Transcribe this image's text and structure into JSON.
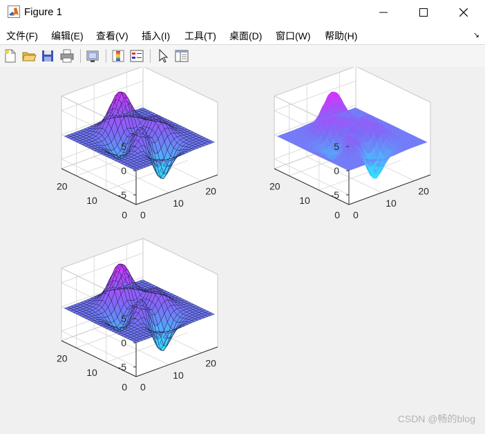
{
  "window": {
    "title": "Figure 1"
  },
  "menu": [
    "文件(F)",
    "编辑(E)",
    "查看(V)",
    "插入(I)",
    "工具(T)",
    "桌面(D)",
    "窗口(W)",
    "帮助(H)"
  ],
  "toolbar": [
    "new-figure-icon",
    "open-file-icon",
    "save-icon",
    "print-icon",
    "link-plot-icon",
    "colorbar-icon",
    "legend-icon",
    "pointer-icon",
    "property-editor-icon"
  ],
  "colors": {
    "colormap_low": "#2fe6ff",
    "colormap_mid": "#7b6cf6",
    "colormap_high": "#e02cff",
    "flat_surface": "#6f86ff",
    "panel_bg": "#f0f0f0"
  },
  "chart_data": [
    {
      "type": "surface",
      "function": "peaks",
      "grid": [
        25,
        25
      ],
      "shading": "faceted",
      "colormap": "cool",
      "zticks": [
        "5",
        "0",
        "-5"
      ],
      "yticks": [
        "20",
        "10",
        "0"
      ],
      "xticks": [
        "0",
        "10",
        "20"
      ],
      "xlim": [
        0,
        25
      ],
      "ylim": [
        0,
        25
      ],
      "zlim": [
        -7,
        8
      ],
      "grid_on": true
    },
    {
      "type": "surface",
      "function": "peaks",
      "grid": [
        25,
        25
      ],
      "shading": "interp",
      "colormap": "cool",
      "zticks": [
        "5",
        "0",
        "-5"
      ],
      "yticks": [
        "20",
        "10",
        "0"
      ],
      "xticks": [
        "0",
        "10",
        "20"
      ],
      "xlim": [
        0,
        25
      ],
      "ylim": [
        0,
        25
      ],
      "zlim": [
        -7,
        8
      ],
      "grid_on": true
    },
    {
      "type": "surface",
      "function": "peaks",
      "grid": [
        25,
        25
      ],
      "shading": "faceted",
      "colormap": "cool",
      "zticks": [
        "5",
        "0",
        "-5"
      ],
      "yticks": [
        "20",
        "10",
        "0"
      ],
      "xticks": [
        "0",
        "10",
        "20"
      ],
      "xlim": [
        0,
        25
      ],
      "ylim": [
        0,
        25
      ],
      "zlim": [
        -7,
        8
      ],
      "grid_on": true
    }
  ],
  "watermark": "CSDN @畅的blog"
}
